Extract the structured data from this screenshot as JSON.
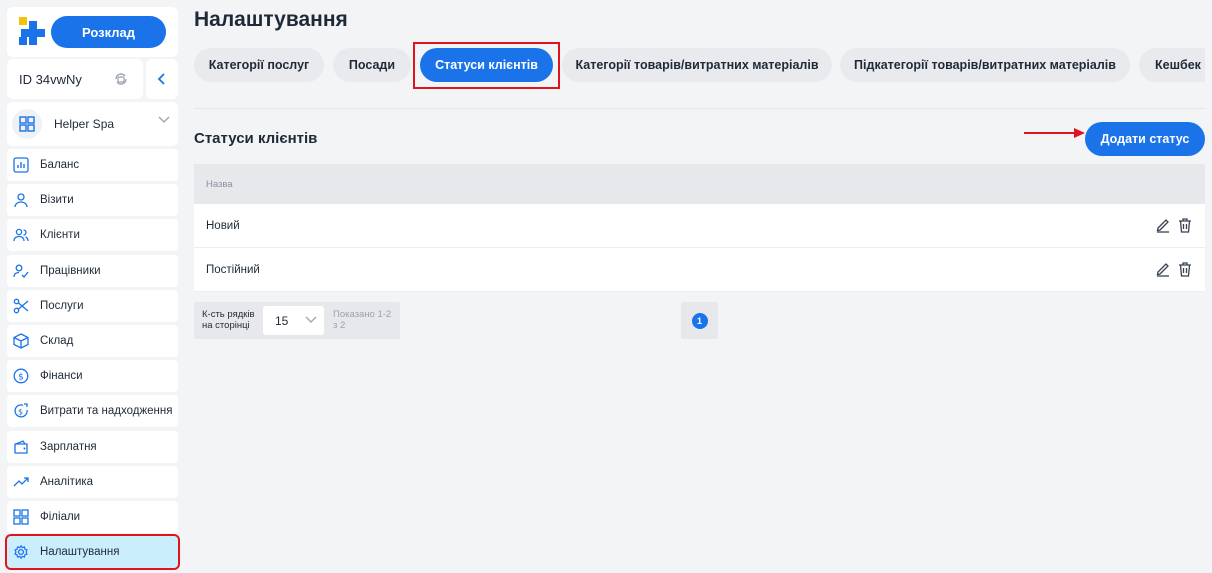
{
  "header": {
    "schedule_label": "Розклад",
    "account_id": "ID 34vwNy",
    "organization": "Helper Spa"
  },
  "sidebar": {
    "items": [
      {
        "label": "Баланс",
        "icon": "chart-bar-icon"
      },
      {
        "label": "Візити",
        "icon": "user-icon"
      },
      {
        "label": "Клієнти",
        "icon": "users-icon"
      },
      {
        "label": "Працівники",
        "icon": "user-check-icon"
      },
      {
        "label": "Послуги",
        "icon": "scissors-icon"
      },
      {
        "label": "Склад",
        "icon": "box-icon"
      },
      {
        "label": "Фінанси",
        "icon": "dollar-circle-icon"
      },
      {
        "label": "Витрати та надходження",
        "icon": "dollar-refresh-icon"
      },
      {
        "label": "Зарплатня",
        "icon": "wallet-icon"
      },
      {
        "label": "Аналітика",
        "icon": "trend-up-icon"
      },
      {
        "label": "Філіали",
        "icon": "grid-icon"
      },
      {
        "label": "Налаштування",
        "icon": "gear-icon"
      }
    ],
    "active_index": 11
  },
  "page": {
    "title": "Налаштування"
  },
  "tabs": [
    {
      "label": "Категорії послуг"
    },
    {
      "label": "Посади"
    },
    {
      "label": "Статуси клієнтів"
    },
    {
      "label": "Категорії товарів/витратних матеріалів"
    },
    {
      "label": "Підкатегорії товарів/витратних матеріалів"
    },
    {
      "label": "Кешбек"
    }
  ],
  "section": {
    "title": "Статуси клієнтів",
    "add_button": "Додати статус"
  },
  "table": {
    "column_name": "Назва",
    "rows": [
      {
        "name": "Новий"
      },
      {
        "name": "Постійний"
      }
    ]
  },
  "pagination": {
    "rows_per_page_label": "К-сть рядків на сторінці",
    "rows_per_page": "15",
    "shown_label": "Показано 1-2 з 2",
    "current_page": "1"
  },
  "colors": {
    "accent": "#1a73e8",
    "highlight": "#e0141e",
    "active_nav": "#cbeefc"
  }
}
